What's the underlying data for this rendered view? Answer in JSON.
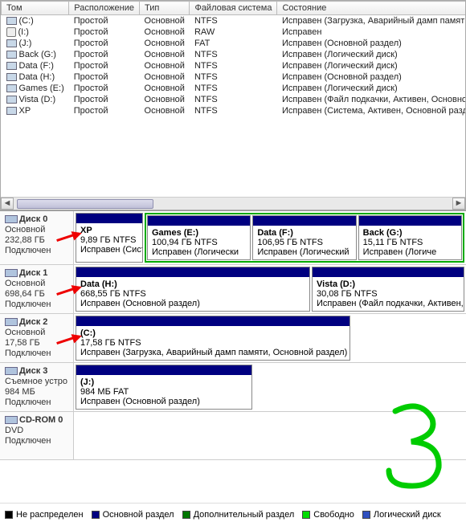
{
  "columns": {
    "volume": "Том",
    "layout": "Расположение",
    "type": "Тип",
    "fs": "Файловая система",
    "status": "Состояние"
  },
  "volumes": [
    {
      "name": "(C:)",
      "layout": "Простой",
      "type": "Основной",
      "fs": "NTFS",
      "status": "Исправен (Загрузка, Аварийный дамп памяти, Основно",
      "iconClass": "vol-icon"
    },
    {
      "name": "(I:)",
      "layout": "Простой",
      "type": "Основной",
      "fs": "RAW",
      "status": "Исправен",
      "iconClass": "usb-icon"
    },
    {
      "name": "(J:)",
      "layout": "Простой",
      "type": "Основной",
      "fs": "FAT",
      "status": "Исправен (Основной раздел)",
      "iconClass": "vol-icon"
    },
    {
      "name": "Back (G:)",
      "layout": "Простой",
      "type": "Основной",
      "fs": "NTFS",
      "status": "Исправен (Логический диск)",
      "iconClass": "vol-icon"
    },
    {
      "name": "Data (F:)",
      "layout": "Простой",
      "type": "Основной",
      "fs": "NTFS",
      "status": "Исправен (Логический диск)",
      "iconClass": "vol-icon"
    },
    {
      "name": "Data (H:)",
      "layout": "Простой",
      "type": "Основной",
      "fs": "NTFS",
      "status": "Исправен (Основной раздел)",
      "iconClass": "vol-icon"
    },
    {
      "name": "Games (E:)",
      "layout": "Простой",
      "type": "Основной",
      "fs": "NTFS",
      "status": "Исправен (Логический диск)",
      "iconClass": "vol-icon"
    },
    {
      "name": "Vista (D:)",
      "layout": "Простой",
      "type": "Основной",
      "fs": "NTFS",
      "status": "Исправен (Файл подкачки, Активен, Основной раздел)",
      "iconClass": "vol-icon"
    },
    {
      "name": "XP",
      "layout": "Простой",
      "type": "Основной",
      "fs": "NTFS",
      "status": "Исправен (Система, Активен, Основной раздел)",
      "iconClass": "vol-icon"
    }
  ],
  "disks": [
    {
      "title": "Диск 0",
      "line1": "Основной",
      "line2": "232,88 ГБ",
      "line3": "Подключен",
      "arrow": true,
      "xp": {
        "name": "XP",
        "size": "9,89 ГБ NTFS",
        "status": "Исправен (Систем"
      },
      "greenParts": [
        {
          "name": "Games  (E:)",
          "size": "100,94 ГБ NTFS",
          "status": "Исправен (Логически"
        },
        {
          "name": "Data  (F:)",
          "size": "106,95 ГБ NTFS",
          "status": "Исправен (Логический"
        },
        {
          "name": "Back  (G:)",
          "size": "15,11 ГБ NTFS",
          "status": "Исправен (Логиче"
        }
      ]
    },
    {
      "title": "Диск 1",
      "line1": "Основной",
      "line2": "698,64 ГБ",
      "line3": "Подключен",
      "arrow": true,
      "parts": [
        {
          "name": "Data  (H:)",
          "size": "668,55 ГБ NTFS",
          "status": "Исправен (Основной раздел)",
          "flex": "1"
        },
        {
          "name": "Vista  (D:)",
          "size": "30,08 ГБ NTFS",
          "status": "Исправен (Файл подкачки, Активен, Осно",
          "flex": "0 0 190px"
        }
      ]
    },
    {
      "title": "Диск 2",
      "line1": "Основной",
      "line2": "17,58 ГБ",
      "line3": "Подключен",
      "arrow": true,
      "parts": [
        {
          "name": "(C:)",
          "size": "17,58 ГБ NTFS",
          "status": "Исправен (Загрузка, Аварийный дамп памяти, Основной раздел)",
          "flex": "0 0 342px"
        }
      ]
    },
    {
      "title": "Диск 3",
      "line1": "Съемное устро",
      "line2": "984 МБ",
      "line3": "Подключен",
      "arrow": false,
      "parts": [
        {
          "name": "(J:)",
          "size": "984 МБ FAT",
          "status": "Исправен (Основной раздел)",
          "flex": "0 0 220px"
        }
      ]
    },
    {
      "title": "CD-ROM 0",
      "line1": "DVD",
      "line2": "",
      "line3": "Подключен",
      "arrow": false,
      "cdrom": true
    }
  ],
  "legend": [
    {
      "label": "Не распределен",
      "color": "#000"
    },
    {
      "label": "Основной раздел",
      "color": "#000080"
    },
    {
      "label": "Дополнительный раздел",
      "color": "#007700"
    },
    {
      "label": "Свободно",
      "color": "#00dd00"
    },
    {
      "label": "Логический диск",
      "color": "#3050c0"
    }
  ]
}
